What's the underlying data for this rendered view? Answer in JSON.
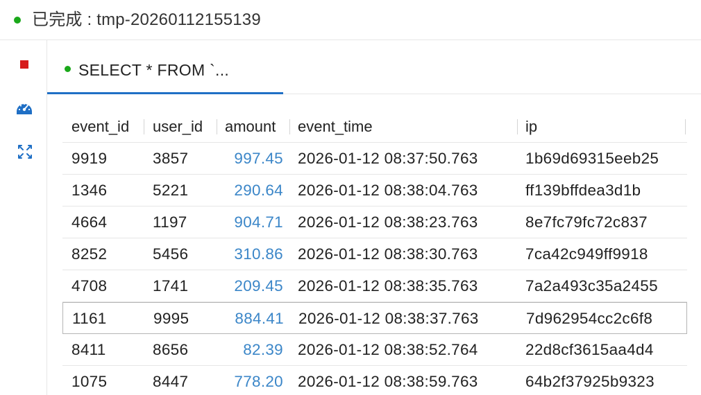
{
  "status": {
    "text": "已完成 : tmp-20260112155139",
    "dot_color": "#1aa81a"
  },
  "toolbar": {
    "icons": [
      "stop-icon",
      "gauge-icon",
      "expand-icon"
    ],
    "stop_color": "#d61b1b",
    "accent_color": "#1f6fc5"
  },
  "tab": {
    "label": "SELECT * FROM `...",
    "dot_color": "#1aa81a"
  },
  "table": {
    "columns": [
      "event_id",
      "user_id",
      "amount",
      "event_time",
      "ip"
    ],
    "rows": [
      [
        "9919",
        "3857",
        "997.45",
        "2026-01-12 08:37:50.763",
        "1b69d69315eeb25"
      ],
      [
        "1346",
        "5221",
        "290.64",
        "2026-01-12 08:38:04.763",
        "ff139bffdea3d1b"
      ],
      [
        "4664",
        "1197",
        "904.71",
        "2026-01-12 08:38:23.763",
        "8e7fc79fc72c837"
      ],
      [
        "8252",
        "5456",
        "310.86",
        "2026-01-12 08:38:30.763",
        "7ca42c949ff9918"
      ],
      [
        "4708",
        "1741",
        "209.45",
        "2026-01-12 08:38:35.763",
        "7a2a493c35a2455"
      ],
      [
        "1161",
        "9995",
        "884.41",
        "2026-01-12 08:38:37.763",
        "7d962954cc2c6f8"
      ],
      [
        "8411",
        "8656",
        "82.39",
        "2026-01-12 08:38:52.764",
        "22d8cf3615aa4d4"
      ],
      [
        "1075",
        "8447",
        "778.20",
        "2026-01-12 08:38:59.763",
        "64b2f37925b9323"
      ]
    ],
    "amount_color": "#3b86c8"
  }
}
